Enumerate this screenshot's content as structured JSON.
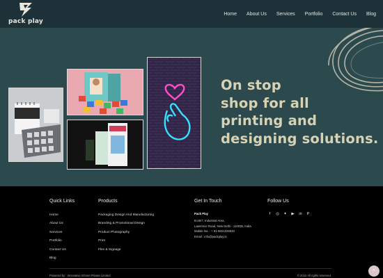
{
  "brand": {
    "name": "pack play"
  },
  "nav": [
    "Home",
    "About Us",
    "Services",
    "Portfolio",
    "Contact Us",
    "Blog"
  ],
  "hero": {
    "tagline": [
      "On stop",
      "shop for all",
      "printing and",
      "designing solutions."
    ],
    "colors": {
      "background": "#2c4a4d",
      "text": "#d8d2b4",
      "header": "#1c3238"
    }
  },
  "footer": {
    "quick_links": {
      "title": "Quick Links",
      "items": [
        "Home",
        "About Us",
        "Services",
        "Portfolio",
        "Contact Us",
        "Blog"
      ]
    },
    "products": {
      "title": "Products",
      "items": [
        "Packaging Design And Manufacturing",
        "Branding & Promotional Design",
        "Product Photography",
        "Print",
        "Flex & Signage"
      ]
    },
    "contact": {
      "title": "Get In Touch",
      "company": "Pack Play",
      "address_line1": "B-28/7, Industrial Area,",
      "address_line2": "Lawrence Road, New Delhi - 110035, India",
      "mobile": "Mobile No. : + 91-9821226533",
      "email": "Email : info@packplay.in"
    },
    "follow": {
      "title": "Follow Us",
      "icons": [
        "facebook-icon",
        "instagram-icon",
        "twitter-icon",
        "youtube-icon",
        "linkedin-icon",
        "pinterest-icon"
      ]
    },
    "powered_by": "Powered by : Innovative Infonet Private Limited",
    "copyright": "© 2022 All rights reserved."
  }
}
